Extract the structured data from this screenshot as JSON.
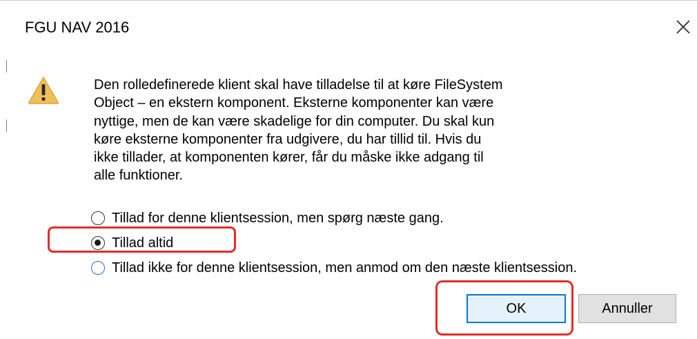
{
  "window": {
    "title": "FGU NAV 2016",
    "close_icon": "close-icon"
  },
  "dialog": {
    "icon": "warning-icon",
    "warning_color": "#f0ad1e",
    "message_lines": [
      "Den rolledefinerede klient skal have tilladelse til at køre FileSystem",
      "Object – en ekstern komponent. Eksterne komponenter kan være",
      "nyttige, men de kan være skadelige for din computer. Du skal kun",
      "køre eksterne komponenter fra udgivere, du har tillid til. Hvis du",
      "ikke tillader, at komponenten kører, får du måske ikke adgang til",
      "alle funktioner."
    ]
  },
  "options": [
    {
      "label": "Tillad for denne klientsession, men spørg næste gang.",
      "selected": false
    },
    {
      "label": "Tillad altid",
      "selected": true
    },
    {
      "label": "Tillad ikke for denne klientsession, men anmod om den næste klientsession.",
      "selected": false
    }
  ],
  "buttons": {
    "ok_label": "OK",
    "cancel_label": "Annuller"
  },
  "annotations": {
    "highlight_color": "#e62a2a"
  }
}
